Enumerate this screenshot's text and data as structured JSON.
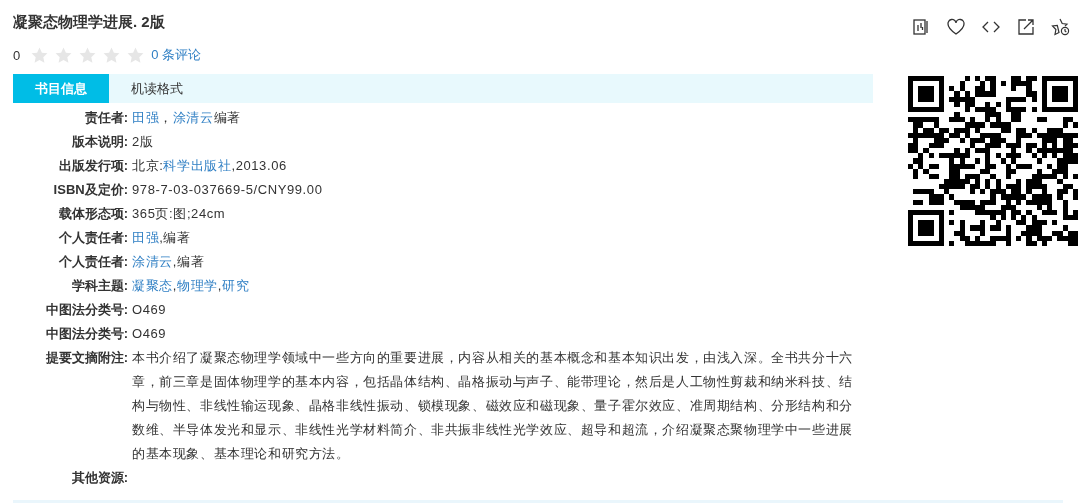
{
  "title": "凝聚态物理学进展. 2版",
  "rating": {
    "score": "0",
    "stars": 0,
    "reviews": "0 条评论"
  },
  "tabs": [
    {
      "label": "书目信息",
      "selected": true
    },
    {
      "label": "机读格式",
      "selected": false
    }
  ],
  "fields": [
    {
      "label": "责任者:",
      "value": [
        {
          "text": "田强",
          "link": true
        },
        {
          "text": "，",
          "link": false
        },
        {
          "text": "涂清云",
          "link": true
        },
        {
          "text": "编著",
          "link": false
        }
      ]
    },
    {
      "label": "版本说明:",
      "value": [
        {
          "text": "2版",
          "link": false
        }
      ]
    },
    {
      "label": "出版发行项:",
      "value": [
        {
          "text": "北京:",
          "link": false
        },
        {
          "text": "科学出版社",
          "link": true
        },
        {
          "text": ",2013.06",
          "link": false
        }
      ]
    },
    {
      "label": "ISBN及定价:",
      "value": [
        {
          "text": "978-7-03-037669-5/CNY99.00",
          "link": false
        }
      ]
    },
    {
      "label": "载体形态项:",
      "value": [
        {
          "text": "365页:图;24cm",
          "link": false
        }
      ]
    },
    {
      "label": "个人责任者:",
      "value": [
        {
          "text": "田强",
          "link": true
        },
        {
          "text": ",编著",
          "link": false
        }
      ]
    },
    {
      "label": "个人责任者:",
      "value": [
        {
          "text": "涂清云",
          "link": true
        },
        {
          "text": ",编著",
          "link": false
        }
      ]
    },
    {
      "label": "学科主题:",
      "value": [
        {
          "text": "凝聚态",
          "link": true
        },
        {
          "text": ",",
          "link": false
        },
        {
          "text": "物理学",
          "link": true
        },
        {
          "text": ",",
          "link": false
        },
        {
          "text": "研究",
          "link": true
        }
      ]
    },
    {
      "label": "中图法分类号:",
      "value": [
        {
          "text": "O469",
          "link": false
        }
      ]
    },
    {
      "label": "中图法分类号:",
      "value": [
        {
          "text": "O469",
          "link": false
        }
      ]
    },
    {
      "label": "提要文摘附注:",
      "value": [
        {
          "text": "本书介绍了凝聚态物理学领域中一些方向的重要进展，内容从相关的基本概念和基本知识出发，由浅入深。全书共分十六章，前三章是固体物理学的基本内容，包括晶体结构、晶格振动与声子、能带理论，然后是人工物性剪裁和纳米科技、结构与物性、非线性输运现象、晶格非线性振动、锁模现象、磁效应和磁现象、量子霍尔效应、准周期结构、分形结构和分数维、半导体发光和显示、非线性光学材料简介、非共振非线性光学效应、超导和超流，介绍凝聚态聚物理学中一些进展的基本现象、基本理论和研究方法。",
          "link": false
        }
      ]
    },
    {
      "label": "其他资源:"
    }
  ]
}
